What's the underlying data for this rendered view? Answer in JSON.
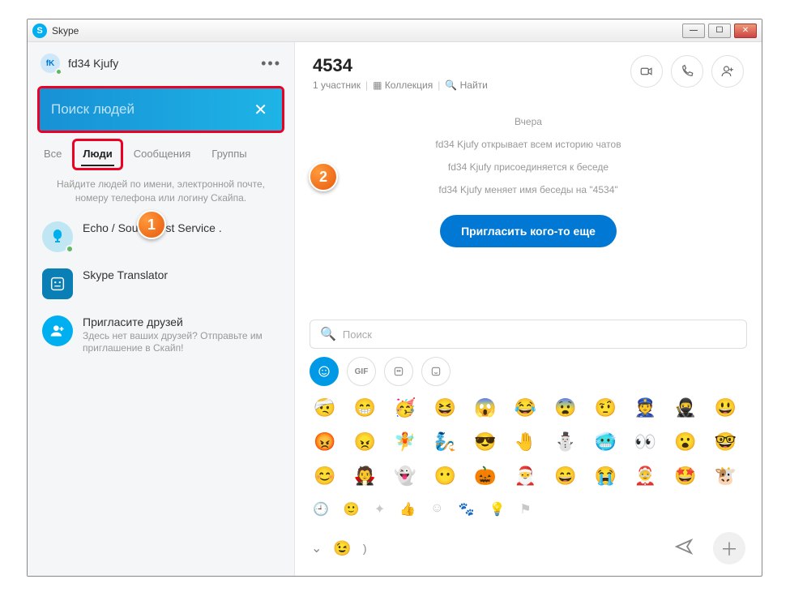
{
  "window": {
    "title": "Skype"
  },
  "profile": {
    "initials": "fK",
    "name": "fd34 Kjufy"
  },
  "search": {
    "placeholder": "Поиск людей"
  },
  "tabs": {
    "all": "Все",
    "people": "Люди",
    "messages": "Сообщения",
    "groups": "Группы"
  },
  "hint": "Найдите людей по имени, электронной почте, номеру телефона или логину Скайпа.",
  "contacts": {
    "echo": "Echo / Sound Test Service .",
    "translator": "Skype Translator",
    "invite_title": "Пригласите друзей",
    "invite_sub": "Здесь нет ваших друзей? Отправьте им приглашение в Скайп!"
  },
  "chat": {
    "title": "4534",
    "participants": "1 участник",
    "collection": "Коллекция",
    "find": "Найти",
    "day": "Вчера",
    "sys1": "fd34 Kjufy открывает всем историю чатов",
    "sys2": "fd34 Kjufy присоединяется к беседе",
    "sys3": "fd34 Kjufy меняет имя беседы на \"4534\"",
    "invite_btn": "Пригласить кого-то еще"
  },
  "compose": {
    "search_placeholder": "Поиск",
    "paren": ")"
  },
  "badges": {
    "one": "1",
    "two": "2"
  }
}
